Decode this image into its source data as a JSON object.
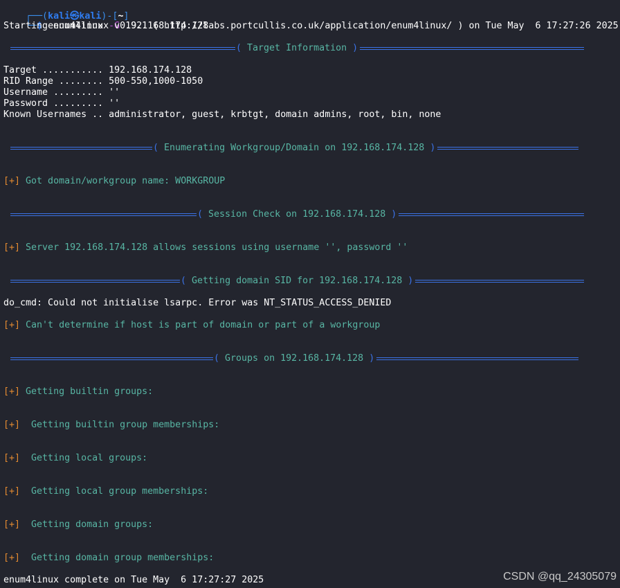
{
  "prompt": {
    "corner_top": "┌──(",
    "user": "kali",
    "at_symbol": "㉿",
    "host": "kali",
    "path_open": ")-[",
    "path": "~",
    "path_close": "]",
    "corner_bottom": "└─",
    "dollar": "$",
    "command": "enum4linux",
    "flag": "-G",
    "argument": "192.168.174.128"
  },
  "starting_line": "Starting enum4linux v0.9.1 ( http://labs.portcullis.co.uk/application/enum4linux/ ) on Tue May  6 17:27:26 2025",
  "banners": {
    "target_info": "Target Information",
    "workgroup": "Enumerating Workgroup/Domain on 192.168.174.128",
    "session": "Session Check on 192.168.174.128",
    "sid": "Getting domain SID for 192.168.174.128",
    "groups": "Groups on 192.168.174.128"
  },
  "target_info": {
    "target": "Target ........... 192.168.174.128",
    "rid_range": "RID Range ........ 500-550,1000-1050",
    "username": "Username ......... ''",
    "password": "Password ......... ''",
    "known_usernames": "Known Usernames .. administrator, guest, krbtgt, domain admins, root, bin, none"
  },
  "plus_marker": "[+]",
  "messages": {
    "workgroup_name": " Got domain/workgroup name: WORKGROUP",
    "session_allowed": " Server 192.168.174.128 allows sessions using username '', password ''",
    "lsarpc_error": "do_cmd: Could not initialise lsarpc. Error was NT_STATUS_ACCESS_DENIED",
    "domain_undetermined": " Can't determine if host is part of domain or part of a workgroup",
    "builtin_groups": " Getting builtin groups:",
    "builtin_memberships": "  Getting builtin group memberships:",
    "local_groups": "  Getting local groups:",
    "local_memberships": "  Getting local group memberships:",
    "domain_groups": "  Getting domain groups:",
    "domain_memberships": "  Getting domain group memberships:"
  },
  "complete_line": "enum4linux complete on Tue May  6 17:27:27 2025",
  "watermark": "CSDN @qq_24305079",
  "colors": {
    "background": "#23252e",
    "text": "#ffffff",
    "prompt_blue": "#3b8eea",
    "rule_blue": "#3b73e8",
    "teal": "#58b6a4",
    "orange": "#e38a30",
    "purple": "#b84ed3"
  }
}
